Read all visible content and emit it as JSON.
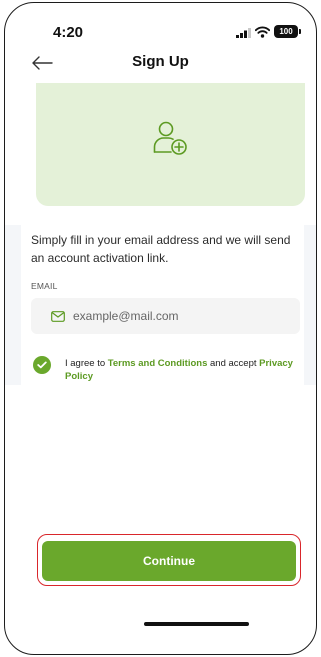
{
  "status_bar": {
    "time": "4:20",
    "battery": "100"
  },
  "header": {
    "title": "Sign Up"
  },
  "form": {
    "description": "Simply fill in your email address and we will send an account activation link.",
    "email_label": "EMAIL",
    "email_placeholder": "example@mail.com",
    "email_value": ""
  },
  "agreement": {
    "checked": true,
    "text_before": "I agree to ",
    "terms_link": "Terms and Conditions",
    "text_middle": " and accept ",
    "privacy_link": "Privacy Policy"
  },
  "actions": {
    "continue_label": "Continue"
  },
  "colors": {
    "accent": "#6aa82c",
    "hero_background": "#e4f1d8",
    "highlight_outline": "#d9262b",
    "input_background": "#f4f4f4"
  },
  "icons": {
    "back": "arrow-left-icon",
    "hero": "add-user-icon",
    "email": "mail-icon",
    "checkbox": "check-icon"
  }
}
